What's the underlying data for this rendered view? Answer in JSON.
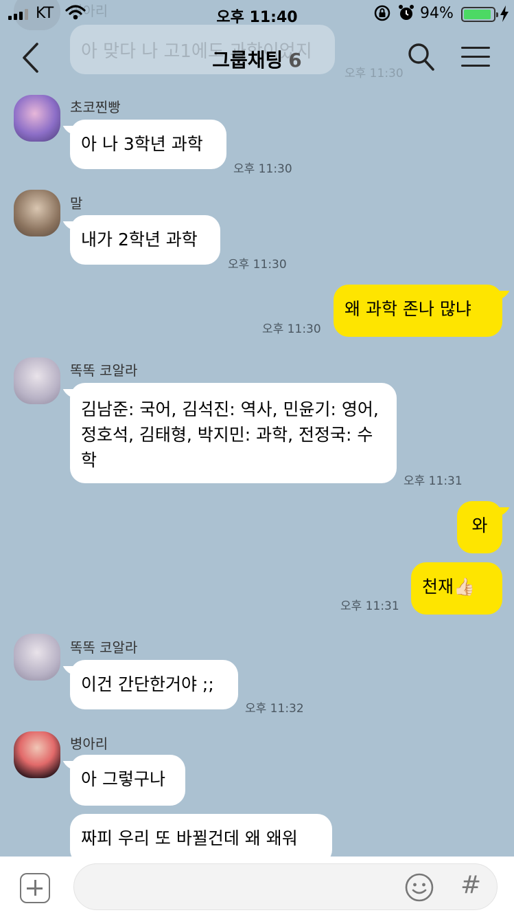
{
  "status_bar": {
    "carrier": "KT",
    "time": "오후 11:40",
    "battery": "94%",
    "battery_level": 0.94
  },
  "header": {
    "title": "그룹채팅",
    "member_count": "6"
  },
  "ghost": {
    "name": "병아리",
    "text": "아 맞다 나 고1에도 과학이었지",
    "time": "오후 11:30"
  },
  "messages": [
    {
      "name": "초코찐빵",
      "text": "아 나 3학년 과학",
      "time": "오후 11:30"
    },
    {
      "name": "말",
      "text": "내가 2학년 과학",
      "time": "오후 11:30"
    },
    {
      "text": "왜 과학 존나 많냐",
      "time": "오후 11:30"
    },
    {
      "name": "똑똑 코알라",
      "text": "김남준: 국어, 김석진: 역사, 민윤기: 영어, 정호석, 김태형, 박지민: 과학, 전정국: 수학",
      "time": "오후 11:31"
    },
    {
      "text": "와"
    },
    {
      "text": "천재",
      "emoji": "👍🏻",
      "time": "오후 11:31"
    },
    {
      "name": "똑똑 코알라",
      "text": "이건 간단한거야 ;;",
      "time": "오후 11:32"
    },
    {
      "name": "병아리",
      "text": "아 그렇구나"
    },
    {
      "text": "짜피 우리 또 바뀔건데 왜 왜워"
    }
  ],
  "input": {
    "placeholder": ""
  },
  "icons": {
    "back": "chevron-left-icon",
    "search": "search-icon",
    "menu": "hamburger-menu-icon",
    "add": "plus-icon",
    "emoji": "emoji-icon",
    "hash": "hash-icon"
  },
  "colors": {
    "background": "#abc1d1",
    "outgoing": "#fee500",
    "incoming": "#ffffff",
    "battery": "#4cd964"
  }
}
